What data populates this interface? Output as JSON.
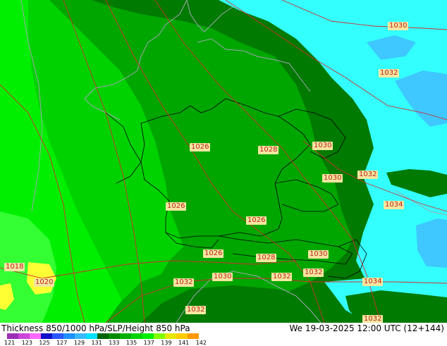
{
  "map": {
    "colors": {
      "cyan": "#33ffff",
      "light_blue": "#3ec8ff",
      "dark_green": "#007a00",
      "green": "#00a600",
      "light_green": "#00d200",
      "bright_green": "#00ef00",
      "lime": "#33ff33",
      "yellow": "#ffff33",
      "coast": "#9ea6ad",
      "border": "#000000",
      "isobar": "#d03030"
    },
    "isobar_labels": [
      "1030",
      "1032",
      "1026",
      "1028",
      "1030",
      "1030",
      "1032",
      "1034",
      "1026",
      "1026",
      "1026",
      "1028",
      "1030",
      "1018",
      "1020",
      "1032",
      "1030",
      "1032",
      "1032",
      "1034",
      "1032",
      "1032"
    ]
  },
  "footer": {
    "title": "Thickness 850/1000 hPa/SLP/Height 850 hPa",
    "valid": "We 19-03-2025 12:00 UTC (12+144)",
    "legend": {
      "colors": [
        "#9b2fb5",
        "#cc44d9",
        "#ff66ff",
        "#1010c8",
        "#2a55ff",
        "#1e90ff",
        "#37b8ff",
        "#00e0ff",
        "#006400",
        "#008a00",
        "#00b000",
        "#00d400",
        "#00ee00",
        "#7fff00",
        "#e6e600",
        "#ffcc00",
        "#ff9900"
      ],
      "labels": [
        "121",
        "123",
        "125",
        "127",
        "129",
        "131",
        "133",
        "135",
        "137",
        "139",
        "141",
        "142"
      ]
    }
  }
}
